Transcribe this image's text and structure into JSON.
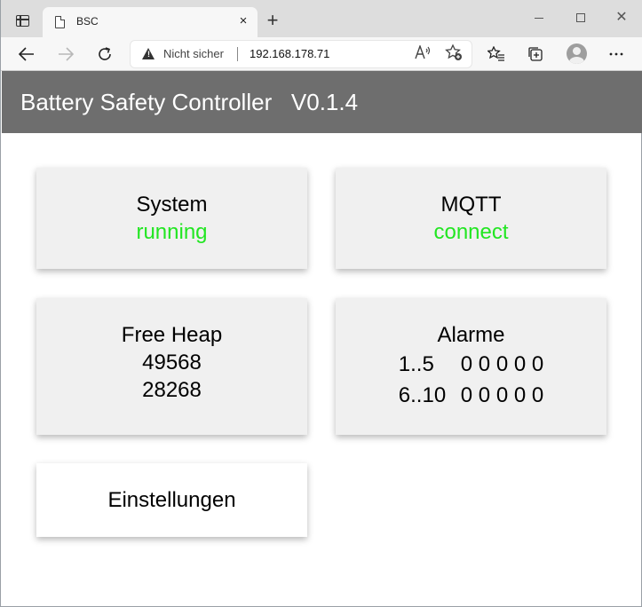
{
  "browser": {
    "tab_title": "BSC",
    "tab_close": "×",
    "new_tab": "+",
    "window_close": "✕",
    "address": {
      "security_label": "Nicht sicher",
      "url": "192.168.178.71"
    },
    "icons": [
      "tab-actions-icon",
      "page-icon",
      "back-icon",
      "forward-icon",
      "reload-icon",
      "warning-icon",
      "read-aloud-icon",
      "add-favorite-icon",
      "favorites-icon",
      "collections-icon",
      "profile-icon",
      "more-icon"
    ]
  },
  "header": {
    "title": "Battery Safety Controller   V0.1.4"
  },
  "cards": {
    "system": {
      "label": "System",
      "status": "running",
      "status_color": "#22e622"
    },
    "mqtt": {
      "label": "MQTT",
      "status": "connect",
      "status_color": "#22e622"
    },
    "heap": {
      "label": "Free Heap",
      "value1": "49568",
      "value2": "28268"
    },
    "alarms": {
      "label": "Alarme",
      "rows": [
        {
          "range": "1..5",
          "values": "0 0 0 0 0"
        },
        {
          "range": "6..10",
          "values": "0 0 0 0 0"
        }
      ]
    },
    "settings": {
      "label": "Einstellungen"
    }
  }
}
